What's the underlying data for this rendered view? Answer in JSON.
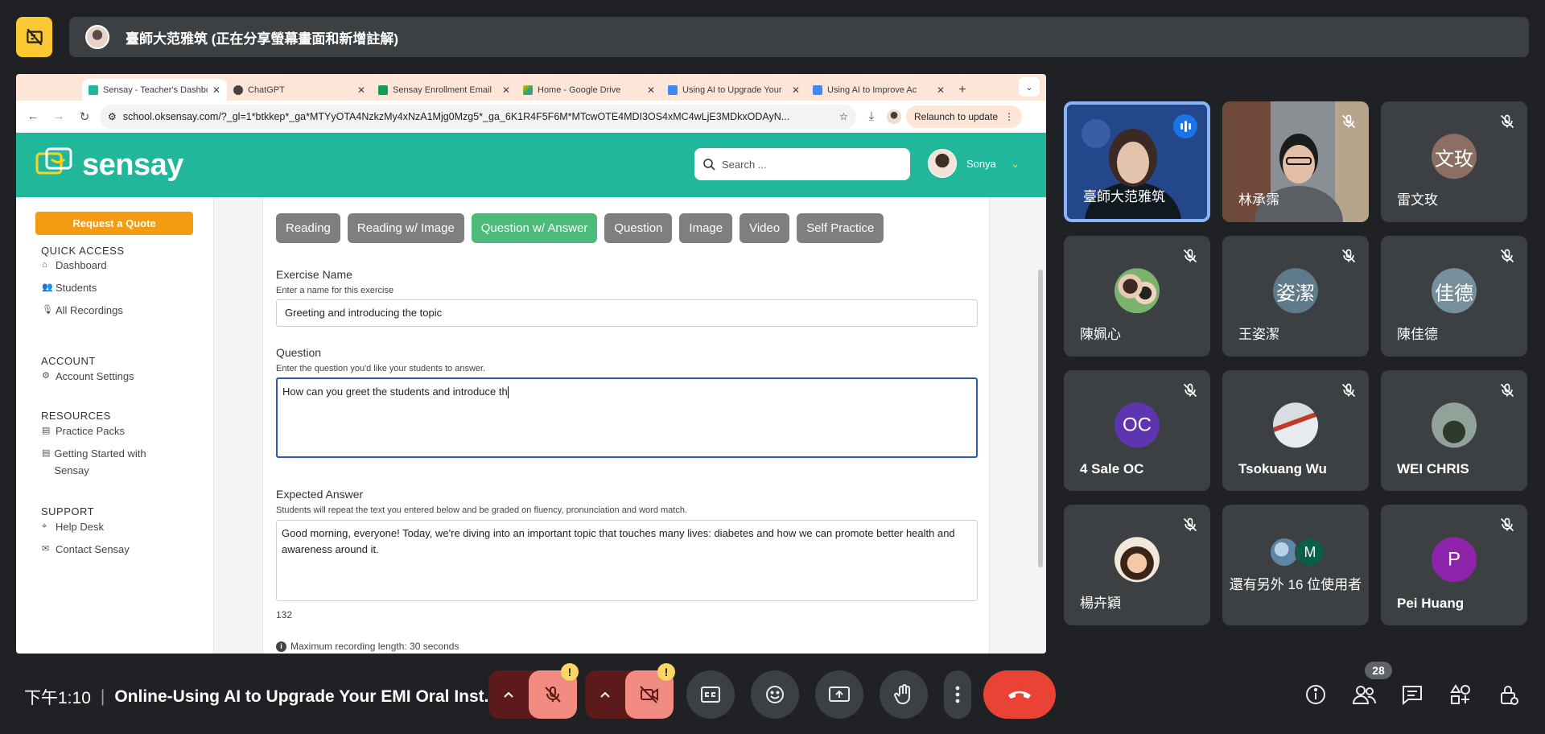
{
  "banner": {
    "presenter_text": "臺師大范雅筑 (正在分享螢幕畫面和新增註解)"
  },
  "browser": {
    "tabs": [
      {
        "title": "Sensay - Teacher's Dashboard",
        "active": true,
        "favicon_color": "#20b79a"
      },
      {
        "title": "ChatGPT",
        "active": false,
        "favicon_color": "#444444"
      },
      {
        "title": "Sensay Enrollment Email",
        "active": false,
        "favicon_color": "#0f9d58"
      },
      {
        "title": "Home - Google Drive",
        "active": false,
        "favicon_color": "#fbbc04"
      },
      {
        "title": "Using AI to Upgrade Your",
        "active": false,
        "favicon_color": "#4285f4"
      },
      {
        "title": "Using AI to Improve Ac",
        "active": false,
        "favicon_color": "#4285f4"
      }
    ],
    "new_tab": "+",
    "url": "school.oksensay.com/?_gl=1*btkkep*_ga*MTYyOTA4NzkzMy4xNzA1Mjg0Mzg5*_ga_6K1R4F5F6M*MTcwOTE4MDI3OS4xMC4wLjE3MDkxODAyN...",
    "relaunch_label": "Relaunch to update"
  },
  "app": {
    "logo_text": "sensay",
    "search_placeholder": "Search ...",
    "user_name": "Sonya",
    "quote_button": "Request a Quote",
    "sidebar": {
      "quick_access": {
        "heading": "QUICK ACCESS",
        "items": [
          {
            "icon": "home-icon",
            "label": "Dashboard"
          },
          {
            "icon": "students-icon",
            "label": "Students"
          },
          {
            "icon": "microphone-icon",
            "label": "All Recordings"
          }
        ]
      },
      "account": {
        "heading": "ACCOUNT",
        "items": [
          {
            "icon": "gear-icon",
            "label": "Account Settings"
          }
        ]
      },
      "resources": {
        "heading": "RESOURCES",
        "items": [
          {
            "icon": "book-icon",
            "label": "Practice Packs"
          },
          {
            "icon": "book-icon",
            "label": "Getting Started with Sensay"
          }
        ]
      },
      "support": {
        "heading": "SUPPORT",
        "items": [
          {
            "icon": "pin-icon",
            "label": "Help Desk"
          },
          {
            "icon": "mail-icon",
            "label": "Contact Sensay"
          }
        ]
      }
    },
    "exercise_types": [
      "Reading",
      "Reading w/ Image",
      "Question w/ Answer",
      "Question",
      "Image",
      "Video",
      "Self Practice"
    ],
    "active_type": "Question w/ Answer",
    "form": {
      "exercise_name_label": "Exercise Name",
      "exercise_name_hint": "Enter a name for this exercise",
      "exercise_name_value": "Greeting and introducing the topic",
      "question_label": "Question",
      "question_hint": "Enter the question you'd like your students to answer.",
      "question_value": "How can you greet the students and introduce th",
      "answer_label": "Expected Answer",
      "answer_hint": "Students will repeat the text you entered below and be graded on fluency, pronunciation and word match.",
      "answer_value": "Good morning, everyone! Today, we're diving into an important topic that touches many lives: diabetes and how we can promote better health and awareness around it.",
      "char_count": "132",
      "max_recording": "Maximum recording length: 30 seconds"
    }
  },
  "participants": [
    {
      "name": "臺師大范雅筑",
      "kind": "video",
      "speaking": true
    },
    {
      "name": "林承霈",
      "kind": "video",
      "muted": true
    },
    {
      "name": "雷文玫",
      "kind": "initials",
      "initials": "文玫",
      "color": "#8d6e63",
      "muted": true
    },
    {
      "name": "陳姵心",
      "kind": "photo",
      "muted": true
    },
    {
      "name": "王姿潔",
      "kind": "initials",
      "initials": "姿潔",
      "color": "#5f7a8a",
      "muted": true
    },
    {
      "name": "陳佳德",
      "kind": "initials",
      "initials": "佳德",
      "color": "#78909c",
      "muted": true
    },
    {
      "name": "4 Sale OC",
      "kind": "initials",
      "initials": "OC",
      "color": "#5e35b1",
      "muted": true
    },
    {
      "name": "Tsokuang Wu",
      "kind": "photo",
      "muted": true
    },
    {
      "name": "WEI CHRIS",
      "kind": "photo",
      "muted": true
    },
    {
      "name": "楊卉穎",
      "kind": "photo",
      "muted": true
    },
    {
      "name": "還有另外 16 位使用者",
      "kind": "others",
      "initials": "M",
      "color": "#0b5e47"
    },
    {
      "name": "Pei Huang",
      "kind": "initials",
      "initials": "P",
      "color": "#8e24aa",
      "muted": true
    }
  ],
  "controls": {
    "time": "下午1:10",
    "meeting_title": "Online-Using AI to Upgrade Your EMI Oral Inst...",
    "people_count": "28",
    "warning_mark": "!"
  },
  "colors": {
    "meet_bg": "#202124",
    "tile_bg": "#3c4043",
    "sensay_green": "#20b79a",
    "quote_orange": "#f39c12",
    "active_type": "#4cbb7a",
    "end_call": "#ea4335",
    "mic_off": "#f28b82"
  }
}
